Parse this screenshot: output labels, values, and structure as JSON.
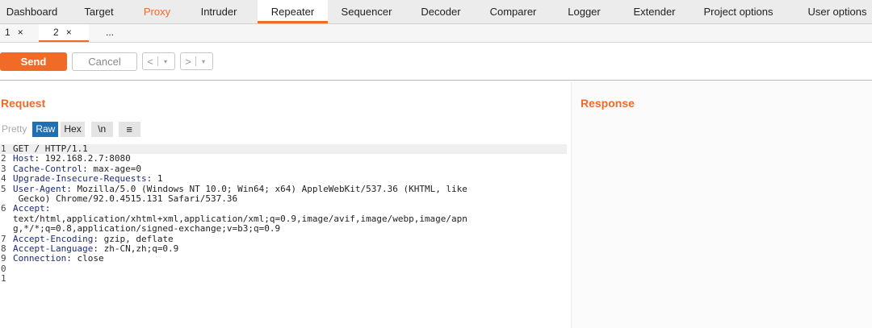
{
  "nav": {
    "tabs": [
      {
        "label": "Dashboard"
      },
      {
        "label": "Target"
      },
      {
        "label": "Proxy"
      },
      {
        "label": "Intruder"
      },
      {
        "label": "Repeater"
      },
      {
        "label": "Sequencer"
      },
      {
        "label": "Decoder"
      },
      {
        "label": "Comparer"
      },
      {
        "label": "Logger"
      },
      {
        "label": "Extender"
      },
      {
        "label": "Project options"
      },
      {
        "label": "User options"
      }
    ],
    "active": "Repeater",
    "highlight": "Proxy"
  },
  "subtabs": {
    "items": [
      {
        "label": "1",
        "close": "×"
      },
      {
        "label": "2",
        "close": "×"
      },
      {
        "label": "..."
      }
    ]
  },
  "toolbar": {
    "send_label": "Send",
    "cancel_label": "Cancel",
    "back_glyph": "<",
    "forward_glyph": ">",
    "dropdown_glyph": "▾"
  },
  "request": {
    "title": "Request",
    "view_tabs": {
      "pretty": "Pretty",
      "raw": "Raw",
      "hex": "Hex",
      "newline": "\\n",
      "menu": "≡"
    },
    "lines": [
      {
        "num": "1",
        "key": "",
        "value": "GET / HTTP/1.1"
      },
      {
        "num": "2",
        "key": "Host",
        "value": ": 192.168.2.7:8080"
      },
      {
        "num": "3",
        "key": "Cache-Control",
        "value": ": max-age=0"
      },
      {
        "num": "4",
        "key": "Upgrade-Insecure-Requests",
        "value": ": 1"
      },
      {
        "num": "5",
        "key": "User-Agent",
        "value": ": Mozilla/5.0 (Windows NT 10.0; Win64; x64) AppleWebKit/537.36 (KHTML, like"
      },
      {
        "num": "",
        "key": "",
        "value": " Gecko) Chrome/92.0.4515.131 Safari/537.36"
      },
      {
        "num": "6",
        "key": "Accept",
        "value": ":"
      },
      {
        "num": "",
        "key": "",
        "value": "text/html,application/xhtml+xml,application/xml;q=0.9,image/avif,image/webp,image/apn"
      },
      {
        "num": "",
        "key": "",
        "value": "g,*/*;q=0.8,application/signed-exchange;v=b3;q=0.9"
      },
      {
        "num": "7",
        "key": "Accept-Encoding",
        "value": ": gzip, deflate"
      },
      {
        "num": "8",
        "key": "Accept-Language",
        "value": ": zh-CN,zh;q=0.9"
      },
      {
        "num": "9",
        "key": "Connection",
        "value": ": close"
      },
      {
        "num": "0",
        "key": "",
        "value": ""
      },
      {
        "num": "1",
        "key": "",
        "value": ""
      }
    ]
  },
  "response": {
    "title": "Response"
  },
  "colors": {
    "accent": "#f06a28",
    "raw_selected": "#1f6fb5",
    "header_key": "#1e2a7a"
  }
}
